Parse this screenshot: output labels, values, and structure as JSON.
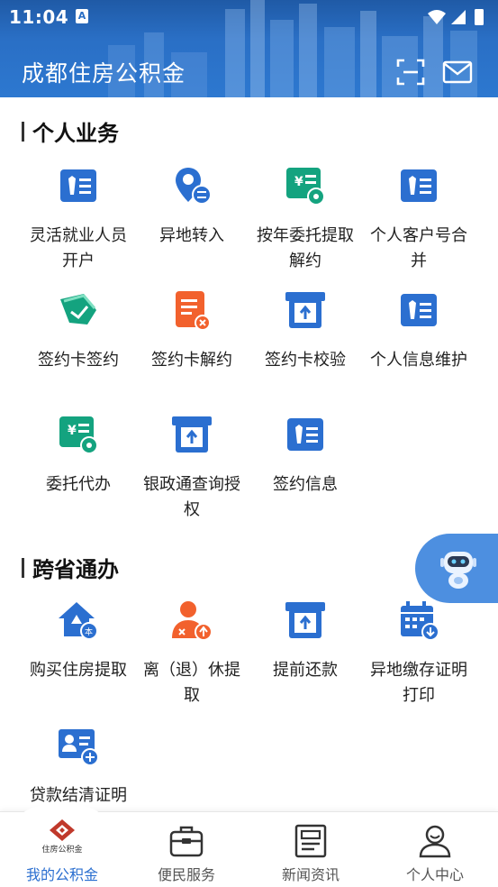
{
  "status_bar": {
    "time": "11:04",
    "app_icon_text": "A"
  },
  "header": {
    "title": "成都住房公积金"
  },
  "colors": {
    "primary": "#2b6fd0",
    "green": "#14a37f",
    "orange": "#f2612d",
    "header_bg": "#2a6fc5"
  },
  "personal": {
    "title": "个人业务",
    "items": [
      {
        "label": "灵活就业人员开户",
        "icon": "id-card-icon"
      },
      {
        "label": "异地转入",
        "icon": "location-transfer-icon"
      },
      {
        "label": "按年委托提取解约",
        "icon": "bill-settings-icon"
      },
      {
        "label": "个人客户号合并",
        "icon": "id-card-icon"
      },
      {
        "label": "签约卡签约",
        "icon": "signed-card-icon"
      },
      {
        "label": "签约卡解约",
        "icon": "cancel-document-icon"
      },
      {
        "label": "签约卡校验",
        "icon": "upload-box-icon"
      },
      {
        "label": "个人信息维护",
        "icon": "id-card-icon"
      },
      {
        "label": "委托代办",
        "icon": "bill-settings-icon"
      },
      {
        "label": "银政通查询授权",
        "icon": "upload-box-icon"
      },
      {
        "label": "签约信息",
        "icon": "id-card-icon"
      }
    ]
  },
  "cross": {
    "title": "跨省通办",
    "items": [
      {
        "label": "购买住房提取",
        "icon": "house-withdraw-icon"
      },
      {
        "label": "离（退）休提取",
        "icon": "retire-user-icon"
      },
      {
        "label": "提前还款",
        "icon": "upload-box-icon"
      },
      {
        "label": "异地缴存证明打印",
        "icon": "calendar-print-icon"
      },
      {
        "label": "贷款结清证明",
        "icon": "user-card-add-icon"
      }
    ]
  },
  "bottom_nav": {
    "items": [
      {
        "label": "我的公积金",
        "icon": "fund-logo-icon",
        "logo_text": "住房公积金"
      },
      {
        "label": "便民服务",
        "icon": "briefcase-icon"
      },
      {
        "label": "新闻资讯",
        "icon": "news-icon"
      },
      {
        "label": "个人中心",
        "icon": "user-icon"
      }
    ],
    "active_index": 0
  }
}
